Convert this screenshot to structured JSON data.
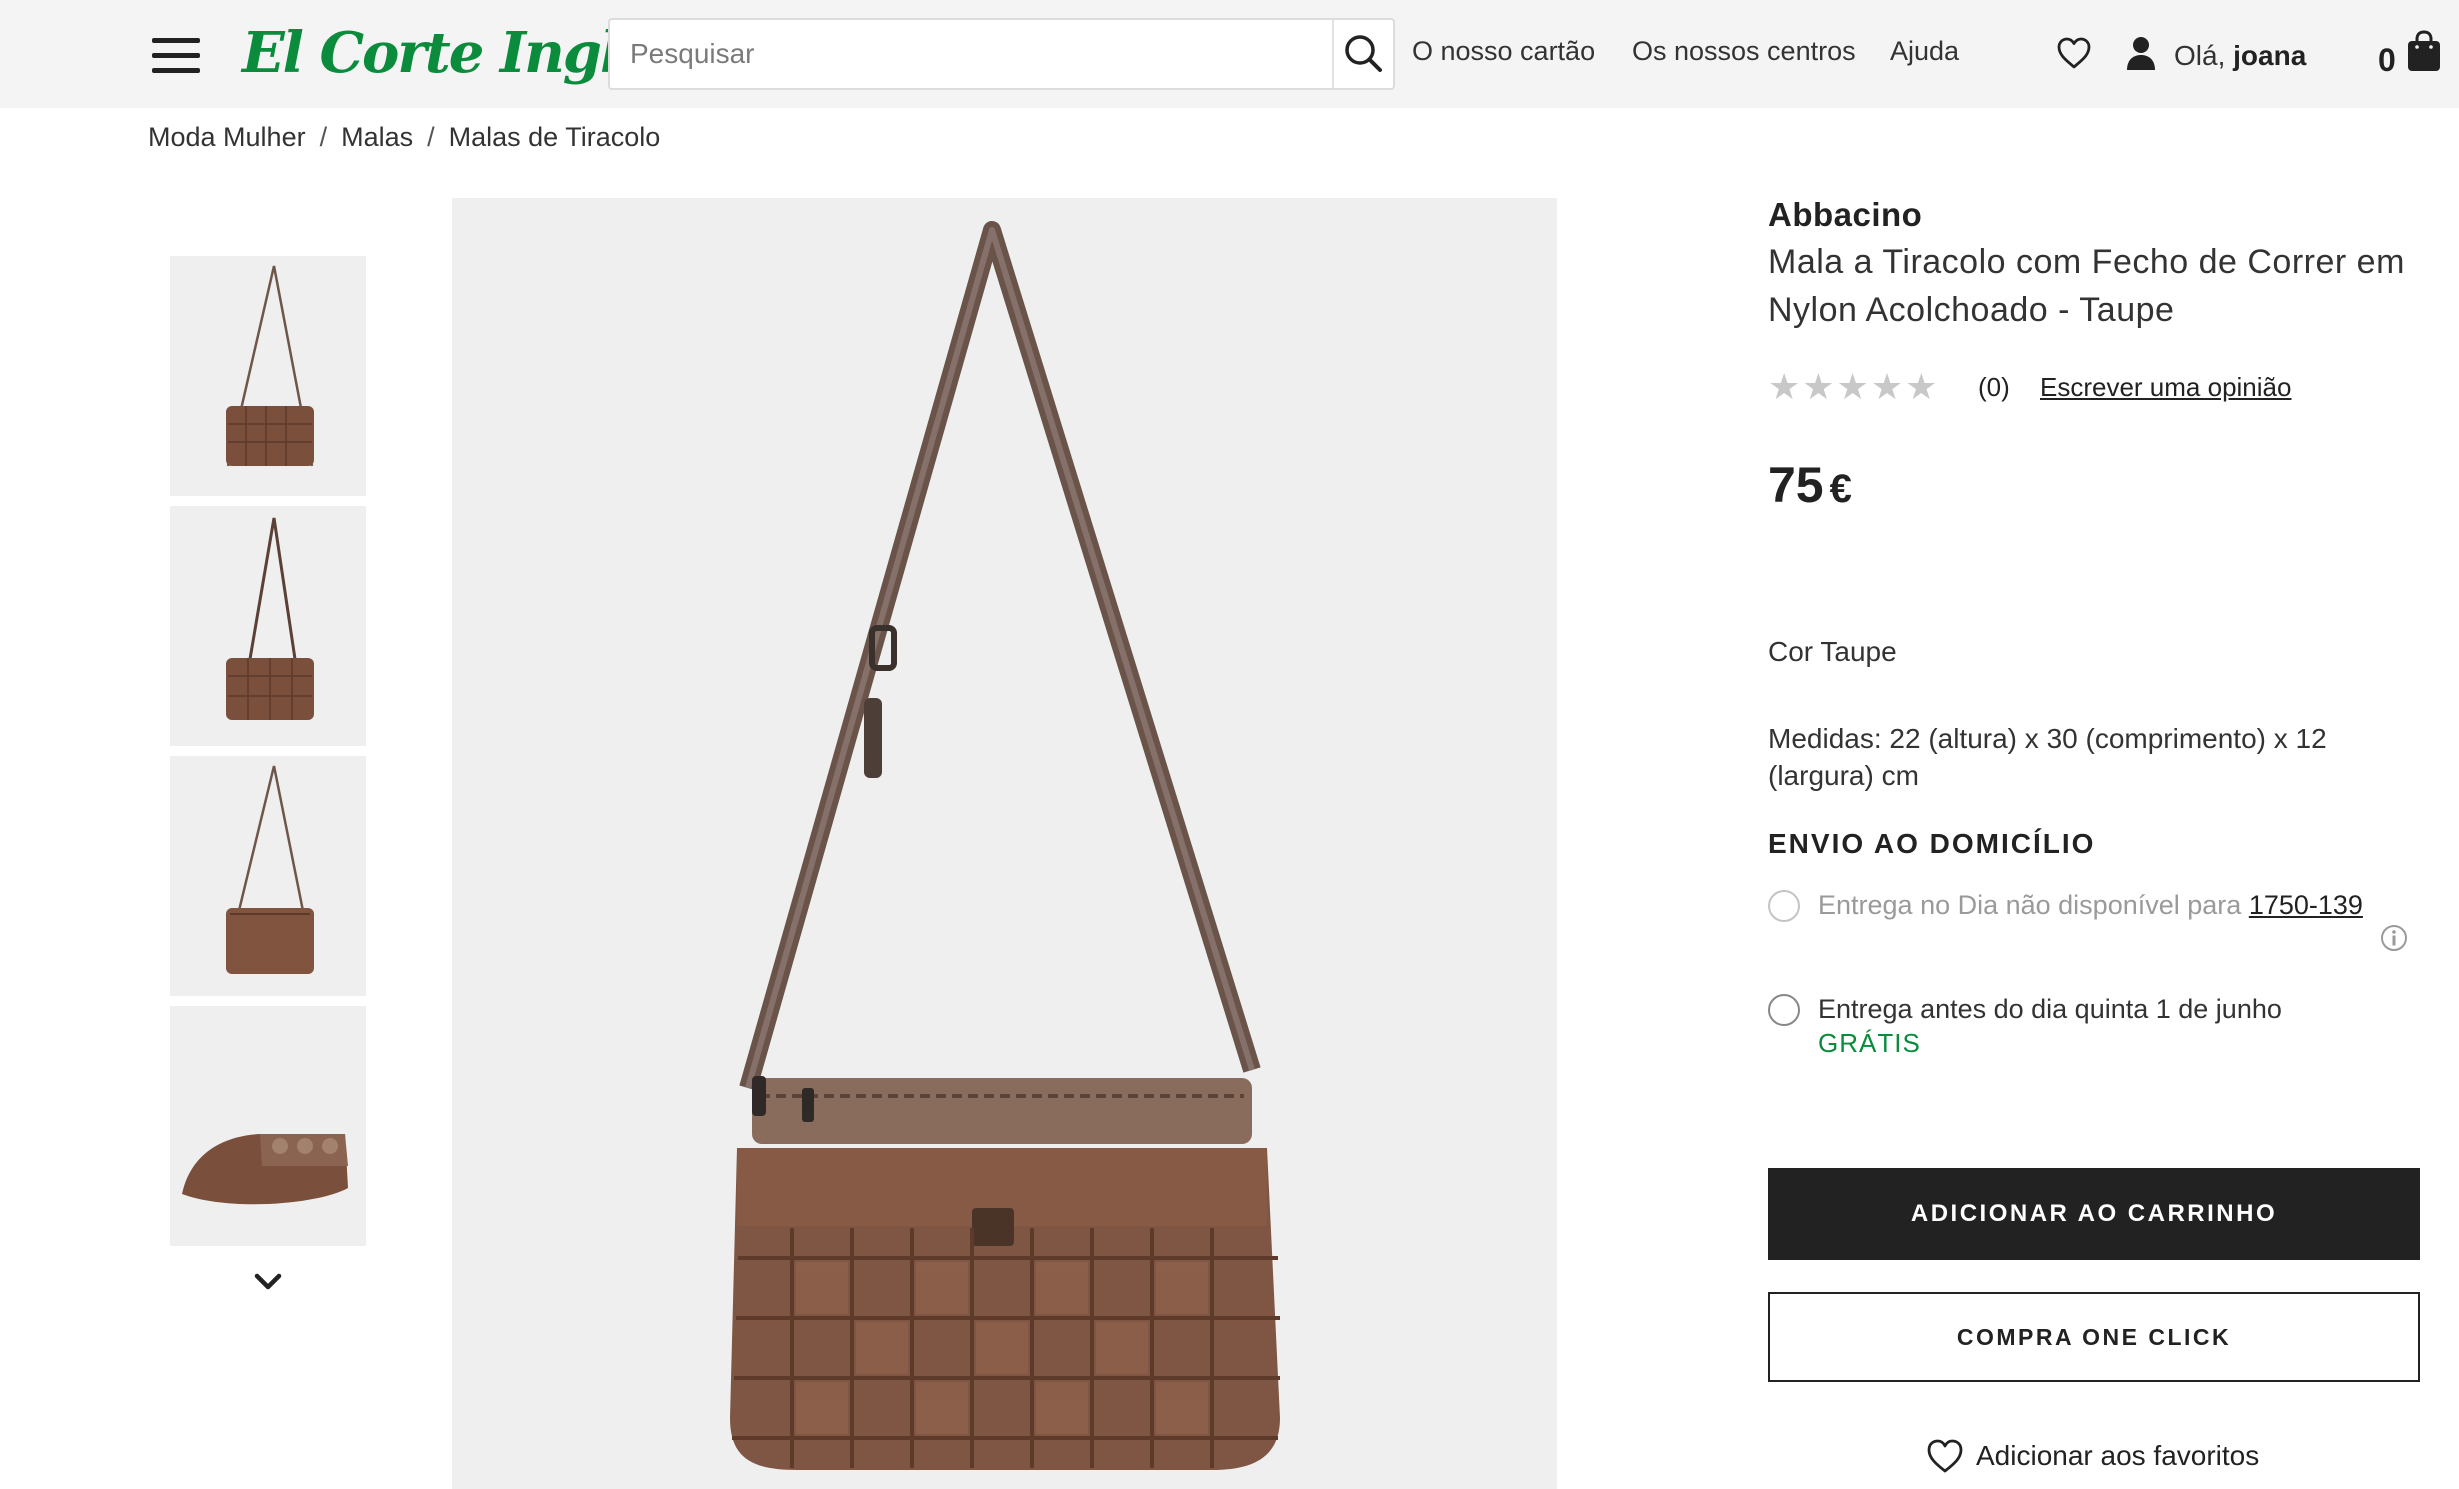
{
  "header": {
    "logo": "El Corte Inglés",
    "search_placeholder": "Pesquisar",
    "nav": [
      "O nosso cartão",
      "Os nossos centros",
      "Ajuda"
    ],
    "greeting_prefix": "Olá,",
    "user_name": "joana",
    "cart_count": "0",
    "brand_color": "#0b8b3c"
  },
  "breadcrumb": [
    "Moda Mulher",
    "Malas",
    "Malas de Tiracolo"
  ],
  "product": {
    "brand": "Abbacino",
    "title": "Mala a Tiracolo com Fecho de Correr em Nylon Acolchoado - Taupe",
    "stars": "★★★★★",
    "rating_count": "(0)",
    "write_review": "Escrever uma opinião",
    "price": "75",
    "currency": "€",
    "color": "Cor Taupe",
    "measures": "Medidas: 22 (altura) x 30 (comprimento) x 12 (largura) cm"
  },
  "shipping": {
    "title": "ENVIO AO DOMICÍLIO",
    "option1_text": "Entrega no Dia não disponível para",
    "option1_postcode": "1750-139",
    "option2_text": "Entrega antes do dia quinta 1 de junho",
    "option2_price": "GRÁTIS"
  },
  "actions": {
    "add_to_cart": "ADICIONAR AO CARRINHO",
    "one_click": "COMPRA ONE CLICK",
    "add_favorite": "Adicionar aos favoritos"
  },
  "icons": [
    "menu-icon",
    "search-icon",
    "heart-icon",
    "user-icon",
    "shopping-bag-icon",
    "chevron-down-icon",
    "info-icon"
  ]
}
